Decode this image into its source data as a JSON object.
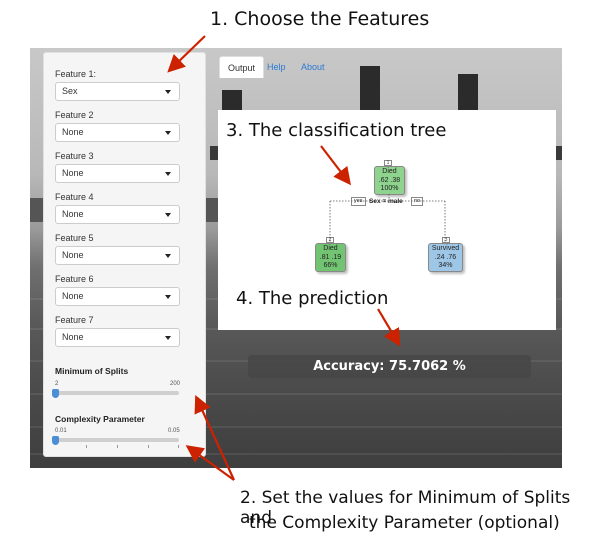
{
  "annotations": {
    "step1": "1. Choose the Features",
    "step2_line1": "2. Set the values for Minimum of Splits and",
    "step2_line2": "the Complexity Parameter (optional)",
    "step3": "3. The classification tree",
    "step4": "4. The prediction"
  },
  "sidebar": {
    "features": [
      {
        "label": "Feature 1:",
        "value": "Sex"
      },
      {
        "label": "Feature 2",
        "value": "None"
      },
      {
        "label": "Feature 3",
        "value": "None"
      },
      {
        "label": "Feature 4",
        "value": "None"
      },
      {
        "label": "Feature 5",
        "value": "None"
      },
      {
        "label": "Feature 6",
        "value": "None"
      },
      {
        "label": "Feature 7",
        "value": "None"
      }
    ],
    "min_splits": {
      "title": "Minimum of Splits",
      "min": "2",
      "max": "200",
      "value_fraction": 0.0
    },
    "complexity": {
      "title": "Complexity Parameter",
      "min": "0.01",
      "max": "0.05",
      "value_fraction": 0.0
    }
  },
  "tabs": [
    {
      "label": "Output",
      "active": true
    },
    {
      "label": "Help",
      "active": false
    },
    {
      "label": "About",
      "active": false
    }
  ],
  "tree": {
    "root": {
      "id": "1",
      "class": "Died",
      "probs": ".62  .38",
      "pct": "100%"
    },
    "split": "Sex = male",
    "yes_label": "yes",
    "no_label": "no",
    "left": {
      "id": "2",
      "class": "Died",
      "probs": ".81  .19",
      "pct": "66%"
    },
    "right": {
      "id": "3",
      "class": "Survived",
      "probs": ".24  .76",
      "pct": "34%"
    }
  },
  "accuracy_text": "Accuracy: 75.7062 %",
  "colors": {
    "arrow": "#cc2200",
    "died_node": "#8ed38e",
    "survived_node": "#9ec6e6",
    "tab_link": "#2a7ad3"
  }
}
